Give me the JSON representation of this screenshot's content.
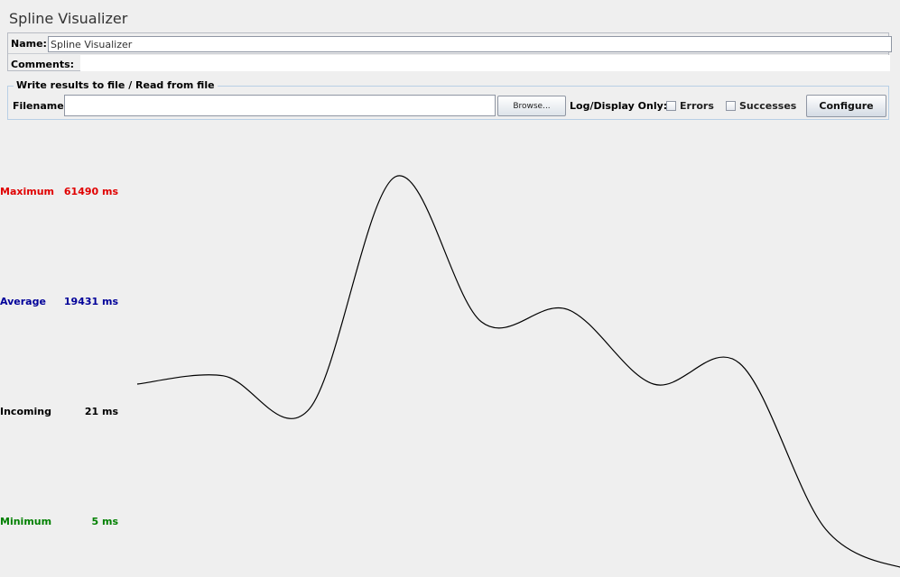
{
  "window": {
    "title": "Spline Visualizer"
  },
  "name_section": {
    "name_label": "Name:",
    "name_value": "Spline Visualizer",
    "comments_label": "Comments:",
    "comments_value": ""
  },
  "file_section": {
    "legend": "Write results to file / Read from file",
    "filename_label": "Filename",
    "filename_value": "",
    "browse_label": "Browse...",
    "log_display_label": "Log/Display Only:",
    "errors_label": "Errors",
    "errors_checked": false,
    "successes_label": "Successes",
    "successes_checked": false,
    "configure_label": "Configure"
  },
  "stats": {
    "maximum": {
      "label": "Maximum",
      "value": "61490 ms",
      "color": "#e00000"
    },
    "average": {
      "label": "Average",
      "value": "19431 ms",
      "color": "#000099"
    },
    "incoming": {
      "label": "Incoming",
      "value": "21 ms",
      "color": "#000000"
    },
    "minimum": {
      "label": "Minimum",
      "value": "5 ms",
      "color": "#008000"
    }
  },
  "chart_data": {
    "type": "line",
    "title": "",
    "xlabel": "",
    "ylabel": "",
    "x": [
      0,
      1,
      2,
      3,
      4,
      5,
      6,
      7,
      8,
      9
    ],
    "series": [
      {
        "values": [
          0.6,
          0.58,
          0.66,
          0.1,
          0.45,
          0.42,
          0.6,
          0.55,
          0.95,
          1.05
        ],
        "color": "#000000"
      }
    ],
    "ylim": [
      0,
      1
    ],
    "grid": false
  }
}
